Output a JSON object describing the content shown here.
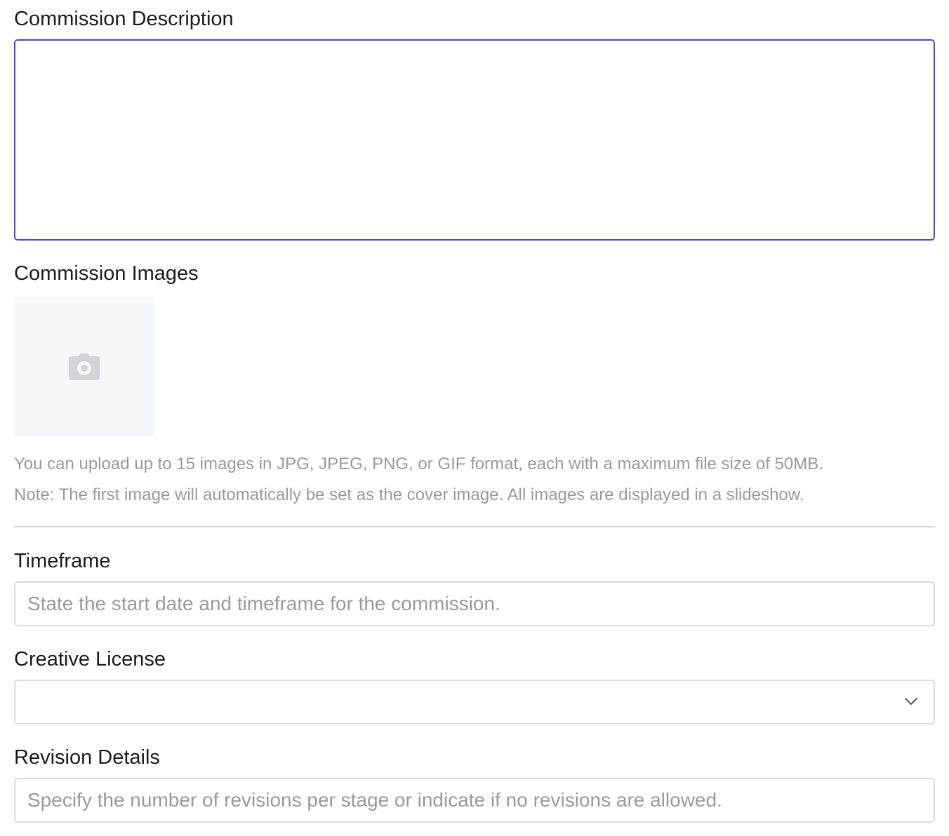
{
  "form": {
    "description": {
      "label": "Commission Description",
      "value": ""
    },
    "images": {
      "label": "Commission Images",
      "upload_icon": "camera-icon",
      "hint_line1": "You can upload up to 15 images in JPG, JPEG, PNG, or GIF format, each with a maximum file size of 50MB.",
      "hint_line2": "Note: The first image will automatically be set as the cover image. All images are displayed in a slideshow."
    },
    "timeframe": {
      "label": "Timeframe",
      "placeholder": "State the start date and timeframe for the commission."
    },
    "license": {
      "label": "Creative License",
      "selected": "",
      "icon": "chevron-down-icon"
    },
    "revisions": {
      "label": "Revision Details",
      "placeholder": "Specify the number of revisions per stage or indicate if no revisions are allowed."
    }
  },
  "colors": {
    "focus_border": "#4f46e5",
    "input_border": "#dcdcdc",
    "placeholder": "#9a9a9a",
    "upload_tile_bg": "#f6f7f8",
    "icon_gray": "#d1d4d8"
  }
}
